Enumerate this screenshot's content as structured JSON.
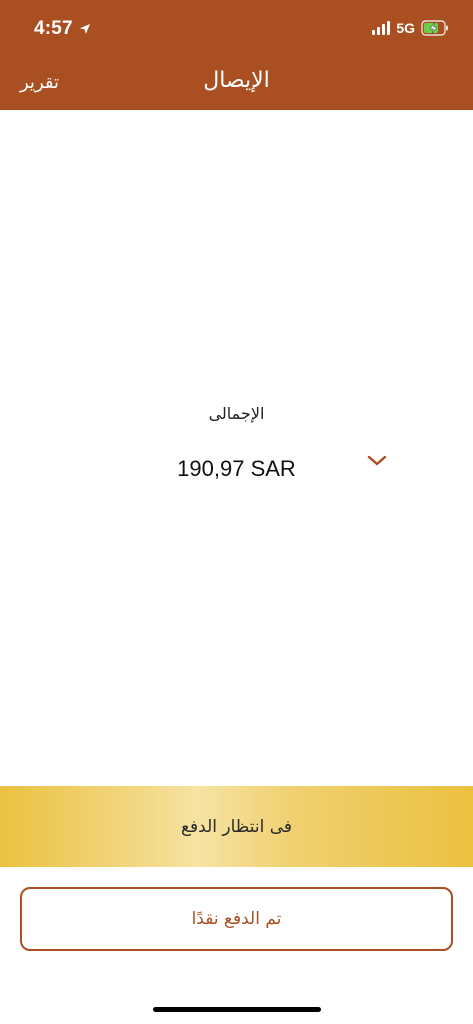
{
  "status_bar": {
    "time": "4:57",
    "network": "5G",
    "signal_bars": 4,
    "battery_state": "charging",
    "icons": [
      "location-arrow-icon",
      "signal-bars-icon",
      "battery-charging-icon"
    ]
  },
  "nav": {
    "title": "الإيصال",
    "report_label": "تقرير"
  },
  "summary": {
    "total_label": "الإجمالى",
    "total_value": "190,97 SAR",
    "expand_icon": "chevron-down-icon"
  },
  "payment_status": {
    "text": "فى انتظار الدفع"
  },
  "actions": {
    "cash_paid_label": "تم الدفع نقدًا"
  },
  "colors": {
    "brand": "#a94f21",
    "banner_gold": "#ebc140",
    "banner_light": "#f6e3a3"
  }
}
